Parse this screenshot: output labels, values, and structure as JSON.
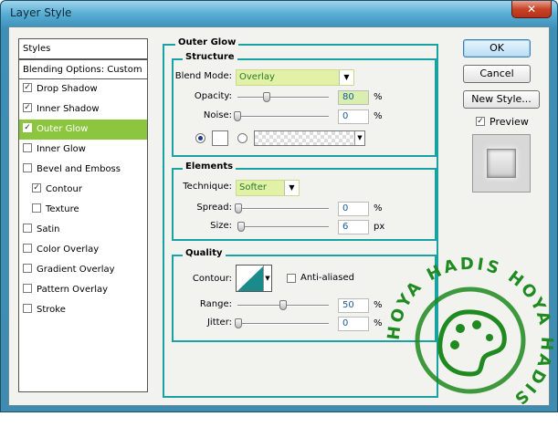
{
  "window": {
    "title": "Layer Style",
    "close_glyph": "✕"
  },
  "left_panel": {
    "header": "Styles",
    "blending": "Blending Options: Custom",
    "items": [
      {
        "label": "Drop Shadow",
        "checked": true,
        "selected": false,
        "indent": false
      },
      {
        "label": "Inner Shadow",
        "checked": true,
        "selected": false,
        "indent": false
      },
      {
        "label": "Outer Glow",
        "checked": true,
        "selected": true,
        "indent": false
      },
      {
        "label": "Inner Glow",
        "checked": false,
        "selected": false,
        "indent": false
      },
      {
        "label": "Bevel and Emboss",
        "checked": false,
        "selected": false,
        "indent": false
      },
      {
        "label": "Contour",
        "checked": true,
        "selected": false,
        "indent": true
      },
      {
        "label": "Texture",
        "checked": false,
        "selected": false,
        "indent": true
      },
      {
        "label": "Satin",
        "checked": false,
        "selected": false,
        "indent": false
      },
      {
        "label": "Color Overlay",
        "checked": false,
        "selected": false,
        "indent": false
      },
      {
        "label": "Gradient Overlay",
        "checked": false,
        "selected": false,
        "indent": false
      },
      {
        "label": "Pattern Overlay",
        "checked": false,
        "selected": false,
        "indent": false
      },
      {
        "label": "Stroke",
        "checked": false,
        "selected": false,
        "indent": false
      }
    ]
  },
  "outer_glow": {
    "title": "Outer Glow",
    "structure": {
      "title": "Structure",
      "blend_mode_label": "Blend Mode:",
      "blend_mode_value": "Overlay",
      "opacity_label": "Opacity:",
      "opacity_value": "80",
      "opacity_unit": "%",
      "noise_label": "Noise:",
      "noise_value": "0",
      "noise_unit": "%",
      "opacity_level": 0.8,
      "noise_level": 0.0
    },
    "elements": {
      "title": "Elements",
      "technique_label": "Technique:",
      "technique_value": "Softer",
      "spread_label": "Spread:",
      "spread_value": "0",
      "spread_unit": "%",
      "size_label": "Size:",
      "size_value": "6",
      "size_unit": "px"
    },
    "quality": {
      "title": "Quality",
      "contour_label": "Contour:",
      "anti_aliased_label": "Anti-aliased",
      "anti_aliased": false,
      "range_label": "Range:",
      "range_value": "50",
      "range_unit": "%",
      "jitter_label": "Jitter:",
      "jitter_value": "0",
      "jitter_unit": "%",
      "contour_color": "#1a8a8a"
    }
  },
  "buttons": {
    "ok": "OK",
    "cancel": "Cancel",
    "new_style": "New Style...",
    "preview_label": "Preview",
    "preview_checked": true
  },
  "colors": {
    "accent": "#18a2a2",
    "selected_item": "#8cc63f",
    "combo_bg": "#e1f1a6",
    "watermark": "#1f8a1f"
  },
  "watermark": {
    "text": "HOYA HADIS HOYA HADIS"
  }
}
